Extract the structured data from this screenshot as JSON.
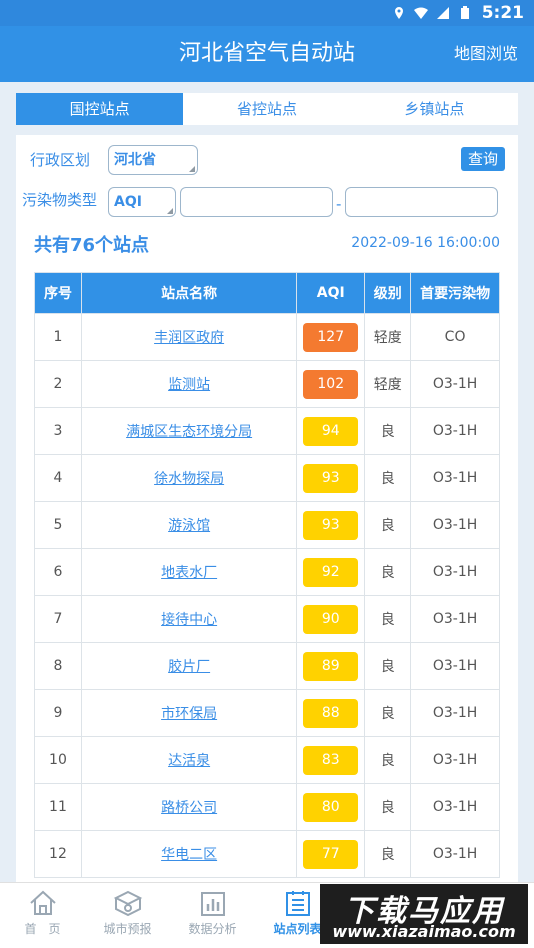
{
  "status_bar": {
    "time": "5:21"
  },
  "header": {
    "title": "河北省空气自动站",
    "map_link": "地图浏览"
  },
  "tabs": [
    {
      "label": "国控站点",
      "active": true
    },
    {
      "label": "省控站点",
      "active": false
    },
    {
      "label": "乡镇站点",
      "active": false
    }
  ],
  "filters": {
    "region_label": "行政区划",
    "region_value": "河北省",
    "query_button": "查询",
    "pollutant_label": "污染物类型",
    "pollutant_value": "AQI",
    "range_separator": "-"
  },
  "summary": {
    "count_text": "共有76个站点",
    "timestamp": "2022-09-16 16:00:00"
  },
  "table": {
    "headers": [
      "序号",
      "站点名称",
      "AQI",
      "级别",
      "首要污染物"
    ],
    "rows": [
      {
        "no": "1",
        "name": "丰润区政府",
        "aqi": "127",
        "level": "轻度",
        "pollutant": "CO",
        "color": "#f47a30"
      },
      {
        "no": "2",
        "name": "监测站",
        "aqi": "102",
        "level": "轻度",
        "pollutant": "O3-1H",
        "color": "#f47a30"
      },
      {
        "no": "3",
        "name": "满城区生态环境分局",
        "aqi": "94",
        "level": "良",
        "pollutant": "O3-1H",
        "color": "#ffd200"
      },
      {
        "no": "4",
        "name": "徐水物探局",
        "aqi": "93",
        "level": "良",
        "pollutant": "O3-1H",
        "color": "#ffd200"
      },
      {
        "no": "5",
        "name": "游泳馆",
        "aqi": "93",
        "level": "良",
        "pollutant": "O3-1H",
        "color": "#ffd200"
      },
      {
        "no": "6",
        "name": "地表水厂",
        "aqi": "92",
        "level": "良",
        "pollutant": "O3-1H",
        "color": "#ffd200"
      },
      {
        "no": "7",
        "name": "接待中心",
        "aqi": "90",
        "level": "良",
        "pollutant": "O3-1H",
        "color": "#ffd200"
      },
      {
        "no": "8",
        "name": "胶片厂",
        "aqi": "89",
        "level": "良",
        "pollutant": "O3-1H",
        "color": "#ffd200"
      },
      {
        "no": "9",
        "name": "市环保局",
        "aqi": "88",
        "level": "良",
        "pollutant": "O3-1H",
        "color": "#ffd200"
      },
      {
        "no": "10",
        "name": "达活泉",
        "aqi": "83",
        "level": "良",
        "pollutant": "O3-1H",
        "color": "#ffd200"
      },
      {
        "no": "11",
        "name": "路桥公司",
        "aqi": "80",
        "level": "良",
        "pollutant": "O3-1H",
        "color": "#ffd200"
      },
      {
        "no": "12",
        "name": "华电二区",
        "aqi": "77",
        "level": "良",
        "pollutant": "O3-1H",
        "color": "#ffd200"
      }
    ]
  },
  "bottom_nav": [
    {
      "label": "首　页",
      "icon": "home-icon",
      "active": false
    },
    {
      "label": "城市预报",
      "icon": "forecast-icon",
      "active": false
    },
    {
      "label": "数据分析",
      "icon": "chart-icon",
      "active": false
    },
    {
      "label": "站点列表",
      "icon": "list-icon",
      "active": true
    }
  ],
  "watermark": {
    "main": "下载马应用",
    "sub": "www.xiazaimao.com"
  },
  "colors": {
    "primary": "#3191e6",
    "moderate": "#f47a30",
    "good": "#ffd200"
  }
}
